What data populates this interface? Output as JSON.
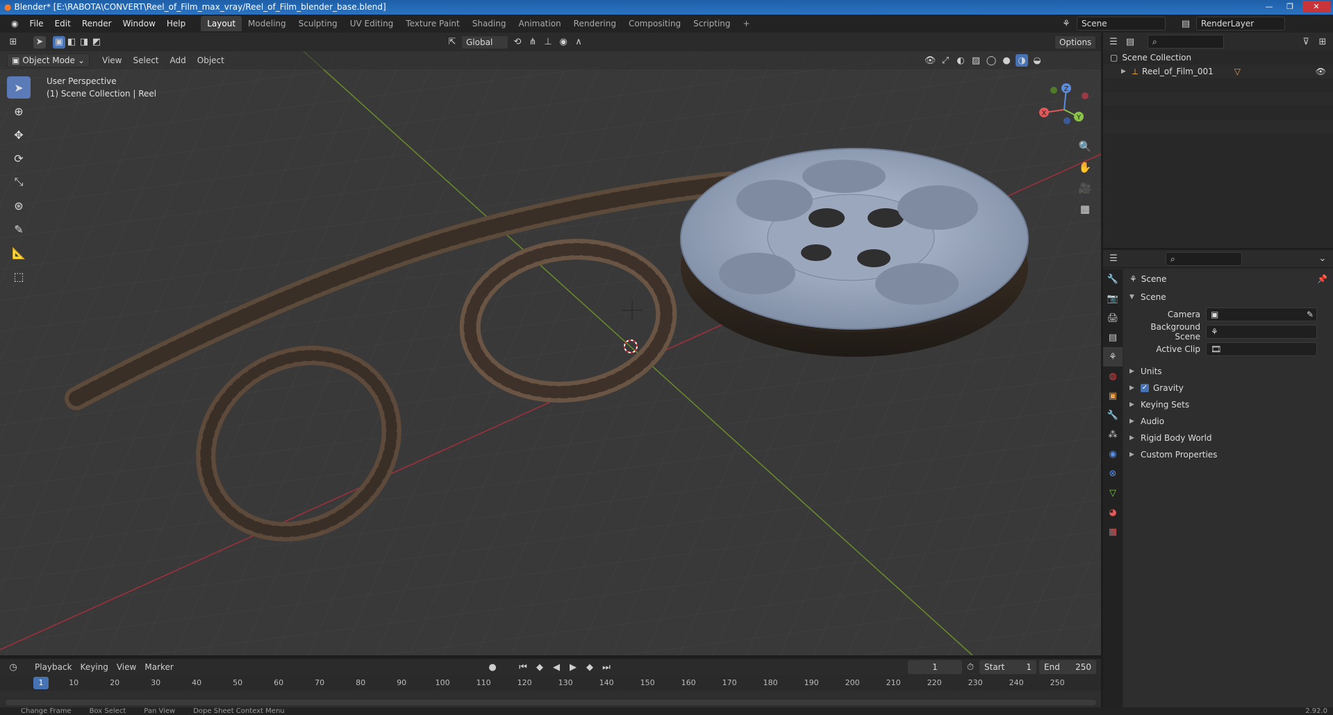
{
  "window": {
    "title": "Blender* [E:\\RABOTA\\CONVERT\\Reel_of_Film_max_vray/Reel_of_Film_blender_base.blend]",
    "app_icon": "blender-icon"
  },
  "menu": [
    "File",
    "Edit",
    "Render",
    "Window",
    "Help"
  ],
  "workspaces": [
    "Layout",
    "Modeling",
    "Sculpting",
    "UV Editing",
    "Texture Paint",
    "Shading",
    "Animation",
    "Rendering",
    "Compositing",
    "Scripting"
  ],
  "active_workspace": "Layout",
  "scene_selector": "Scene",
  "view_layer": "RenderLayer",
  "viewport_header": {
    "transform_orientation": "Global",
    "options_label": "Options"
  },
  "viewport_menu": {
    "mode": "Object Mode",
    "items": [
      "View",
      "Select",
      "Add",
      "Object"
    ]
  },
  "viewport_overlay": {
    "line1": "User Perspective",
    "line2": "(1) Scene Collection | Reel"
  },
  "gizmo": {
    "x": "X",
    "y": "Y",
    "z": "Z"
  },
  "outliner": {
    "root": "Scene Collection",
    "items": [
      "Reel_of_Film_001"
    ]
  },
  "properties": {
    "context_title": "Scene",
    "section_title": "Scene",
    "fields": [
      {
        "label": "Camera",
        "value": ""
      },
      {
        "label": "Background Scene",
        "value": ""
      },
      {
        "label": "Active Clip",
        "value": ""
      }
    ],
    "panels": [
      "Units",
      "Gravity",
      "Keying Sets",
      "Audio",
      "Rigid Body World",
      "Custom Properties"
    ],
    "gravity_checked": true
  },
  "timeline": {
    "menus": [
      "Playback",
      "Keying",
      "View",
      "Marker"
    ],
    "current_frame": "1",
    "start_label": "Start",
    "start": "1",
    "end_label": "End",
    "end": "250",
    "ticks": [
      "1",
      "10",
      "20",
      "30",
      "40",
      "50",
      "60",
      "70",
      "80",
      "90",
      "100",
      "110",
      "120",
      "130",
      "140",
      "150",
      "160",
      "170",
      "180",
      "190",
      "200",
      "210",
      "220",
      "230",
      "240",
      "250"
    ]
  },
  "statusbar": [
    "Change Frame",
    "Box Select",
    "Pan View",
    "Dope Sheet Context Menu"
  ],
  "version": "2.92.0"
}
